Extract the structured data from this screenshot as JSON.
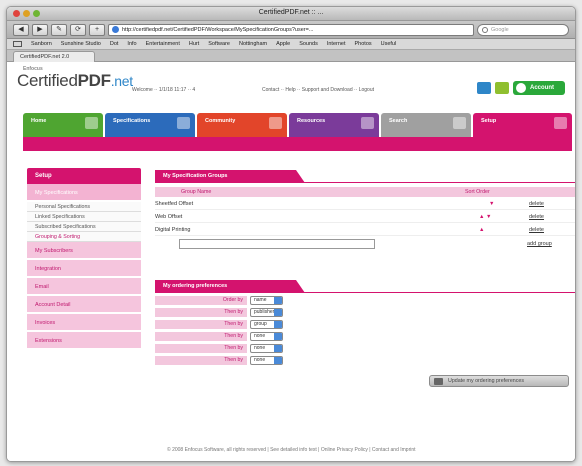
{
  "window": {
    "title": "CertifiedPDF.net :: ..."
  },
  "toolbar": {
    "back": "◀",
    "forward": "▶",
    "edit": "✎",
    "reload": "⟳",
    "add": "+",
    "url": "http://certifiedpdf.net/CertifiedPDF/Workspace/MySpecificationGroups?user=...",
    "search_placeholder": "Google"
  },
  "bookmarks": [
    "Sanborn",
    "Sunshine Studio",
    "Dot",
    "Info",
    "Entertainment",
    "Hurt",
    "Software",
    "Nottingham",
    "Apple",
    "Sounds",
    "Internet",
    "Photos",
    "Useful"
  ],
  "browser_tab": "CertifiedPDF.net 2.0",
  "header": {
    "logo_small": "Enfocus",
    "logo_main": "Certified",
    "logo_bold": "PDF",
    "logo_tld": ".net",
    "info": "Welcome ·· 1/1/18 11:17 ·· 4",
    "links": "Contact ·· Help ·· Support and Download ·· Logout",
    "account": "Account",
    "icon_color_1": "#2e86c8",
    "icon_color_2": "#8fbf2f"
  },
  "nav": [
    {
      "label": "Home",
      "color": "#4fa531"
    },
    {
      "label": "Specifications",
      "color": "#2c6bbb"
    },
    {
      "label": "Community",
      "color": "#e2452a"
    },
    {
      "label": "Resources",
      "color": "#7b3b9a"
    },
    {
      "label": "Search",
      "color": "#a0a0a0"
    },
    {
      "label": "Setup",
      "color": "#d4136e"
    }
  ],
  "sidebar": {
    "title": "Setup",
    "items": [
      "My Specifications",
      "My Subscribers",
      "Integration",
      "Email",
      "Account Detail",
      "Invoices",
      "Extensions"
    ],
    "subitems": [
      "Personal Specifications",
      "Linked Specifications",
      "Subscribed Specifications",
      "Grouping & Sorting"
    ]
  },
  "groups": {
    "title": "My Specification Groups",
    "col_name": "Group Name",
    "col_sort": "Sort Order",
    "rows": [
      {
        "name": "Sheetfed Offset",
        "arrows": "▼",
        "action": "delete"
      },
      {
        "name": "Web Offset",
        "arrows": "▲ ▼",
        "action": "delete"
      },
      {
        "name": "Digital Printing",
        "arrows": "▲",
        "action": "delete"
      }
    ],
    "add_label": "add group"
  },
  "ordering": {
    "title": "My ordering preferences",
    "rows": [
      {
        "label": "Order by",
        "value": "name"
      },
      {
        "label": "Then by",
        "value": "publisher"
      },
      {
        "label": "Then by",
        "value": "group"
      },
      {
        "label": "Then by",
        "value": "none"
      },
      {
        "label": "Then by",
        "value": "none"
      },
      {
        "label": "Then by",
        "value": "none"
      }
    ],
    "update_label": "Update my ordering preferences"
  },
  "footer": "© 2008 Enfocus Software, all rights reserved | See detailed info text | Online Privacy Policy | Contact and Imprint"
}
